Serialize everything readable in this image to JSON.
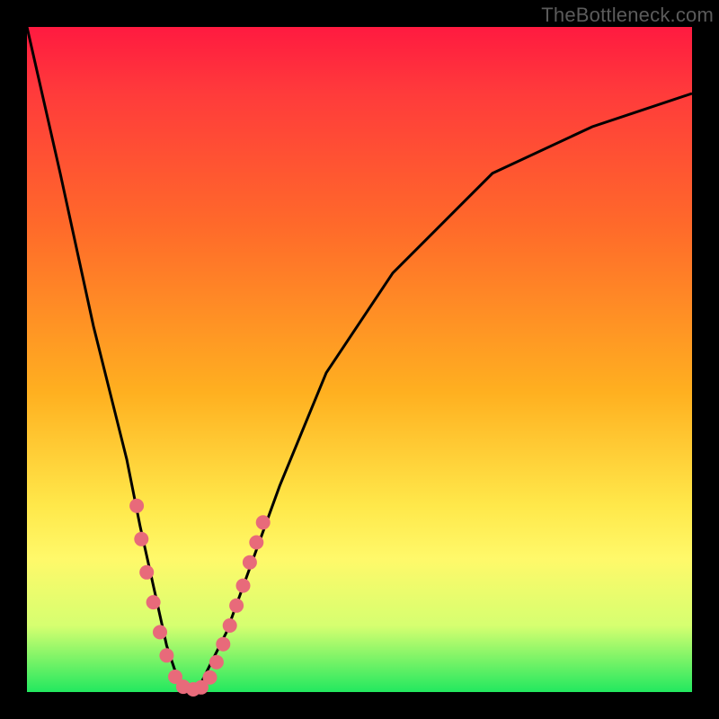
{
  "watermark": "TheBottleneck.com",
  "chart_data": {
    "type": "line",
    "title": "",
    "xlabel": "",
    "ylabel": "",
    "xlim": [
      0,
      100
    ],
    "ylim": [
      0,
      100
    ],
    "series": [
      {
        "name": "curve",
        "x": [
          0,
          5,
          10,
          15,
          17,
          19,
          21,
          23,
          25,
          26,
          30,
          34,
          38,
          45,
          55,
          70,
          85,
          100
        ],
        "y": [
          100,
          78,
          55,
          35,
          25,
          16,
          7,
          1,
          0,
          1,
          9,
          20,
          31,
          48,
          63,
          78,
          85,
          90
        ]
      }
    ],
    "markers": {
      "color": "#e86a7a",
      "radius": 8,
      "points": [
        {
          "x": 16.5,
          "y": 28
        },
        {
          "x": 17.2,
          "y": 23
        },
        {
          "x": 18.0,
          "y": 18
        },
        {
          "x": 19.0,
          "y": 13.5
        },
        {
          "x": 20.0,
          "y": 9
        },
        {
          "x": 21.0,
          "y": 5.5
        },
        {
          "x": 22.3,
          "y": 2.3
        },
        {
          "x": 23.5,
          "y": 0.8
        },
        {
          "x": 25.0,
          "y": 0.4
        },
        {
          "x": 26.2,
          "y": 0.7
        },
        {
          "x": 27.5,
          "y": 2.2
        },
        {
          "x": 28.5,
          "y": 4.5
        },
        {
          "x": 29.5,
          "y": 7.2
        },
        {
          "x": 30.5,
          "y": 10
        },
        {
          "x": 31.5,
          "y": 13
        },
        {
          "x": 32.5,
          "y": 16
        },
        {
          "x": 33.5,
          "y": 19.5
        },
        {
          "x": 34.5,
          "y": 22.5
        },
        {
          "x": 35.5,
          "y": 25.5
        }
      ]
    },
    "colors": {
      "gradient_top": "#ff1a40",
      "gradient_mid1": "#ff6a2a",
      "gradient_mid2": "#ffe84a",
      "gradient_bottom": "#22e85f",
      "curve": "#000000",
      "marker": "#e86a7a",
      "frame": "#000000"
    }
  }
}
